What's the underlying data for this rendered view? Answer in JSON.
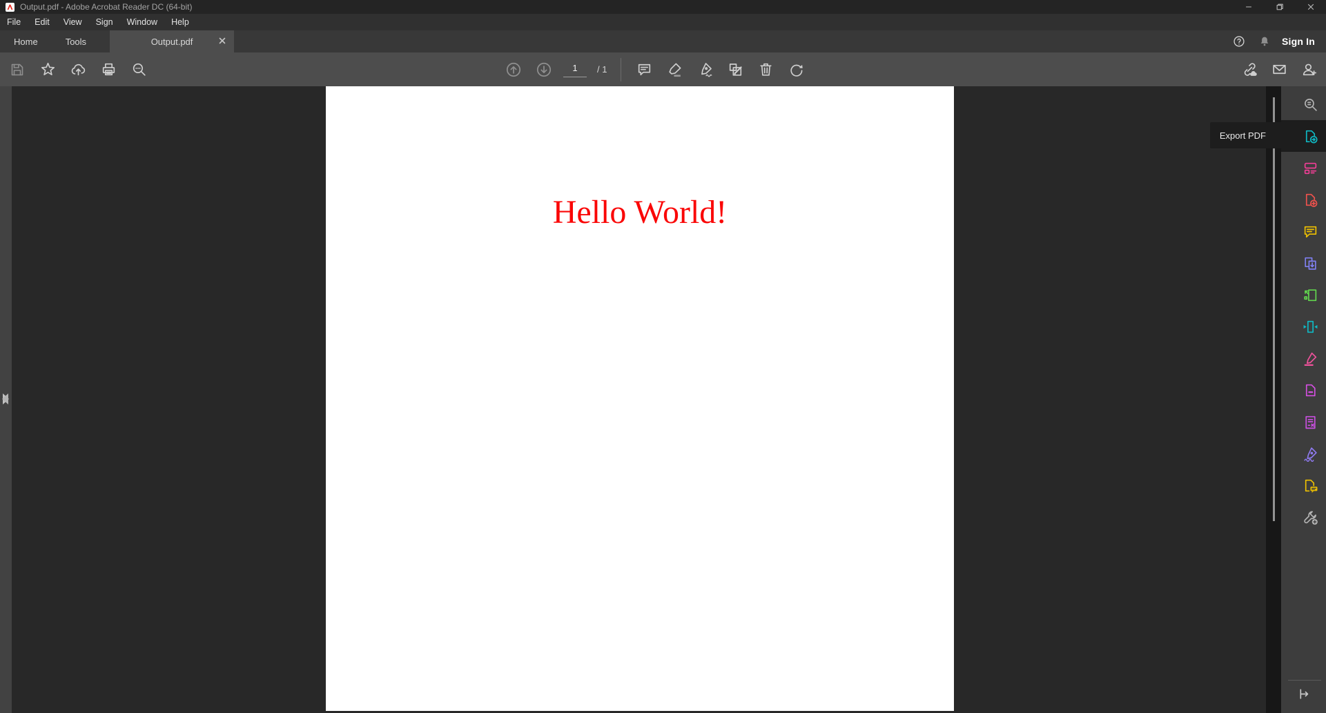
{
  "window": {
    "title": "Output.pdf - Adobe Acrobat Reader DC (64-bit)"
  },
  "menu": {
    "items": [
      "File",
      "Edit",
      "View",
      "Sign",
      "Window",
      "Help"
    ]
  },
  "tabs": {
    "home": "Home",
    "tools": "Tools",
    "document": "Output.pdf"
  },
  "header_right": {
    "sign_in": "Sign In"
  },
  "toolbar": {
    "page_current": "1",
    "page_total": "/ 1"
  },
  "tooltip": {
    "export_pdf": "Export PDF"
  },
  "document": {
    "text": "Hello World!",
    "text_color": "#fa0606",
    "page_background": "#ffffff"
  },
  "right_rail": {
    "items": [
      {
        "name": "find-text",
        "color": "#b3b3b3",
        "active": false
      },
      {
        "name": "export-pdf",
        "color": "#0fb9c4",
        "active": true
      },
      {
        "name": "edit-pdf",
        "color": "#f23e96",
        "active": false
      },
      {
        "name": "create-pdf",
        "color": "#f0524d",
        "active": false
      },
      {
        "name": "comment",
        "color": "#efc100",
        "active": false
      },
      {
        "name": "combine-files",
        "color": "#7f7ff0",
        "active": false
      },
      {
        "name": "organize-pages",
        "color": "#62d84e",
        "active": false
      },
      {
        "name": "compress-pdf",
        "color": "#0fb9c4",
        "active": false
      },
      {
        "name": "redact",
        "color": "#f0529c",
        "active": false
      },
      {
        "name": "protect-pdf",
        "color": "#d44fe0",
        "active": false
      },
      {
        "name": "prepare-form",
        "color": "#c94fe0",
        "active": false
      },
      {
        "name": "fill-and-sign",
        "color": "#8f7af0",
        "active": false
      },
      {
        "name": "send-for-comments",
        "color": "#efc100",
        "active": false
      },
      {
        "name": "more-tools",
        "color": "#b3b3b3",
        "active": false
      }
    ]
  },
  "colors": {
    "titlebar": "#242424",
    "menubar": "#303030",
    "tabbar": "#383838",
    "toolbar": "#4d4d4d",
    "canvas": "#282828",
    "rail": "#3d3d3d",
    "tooltip_bg": "#1d1d1d",
    "logo_red": "#e8281f"
  }
}
